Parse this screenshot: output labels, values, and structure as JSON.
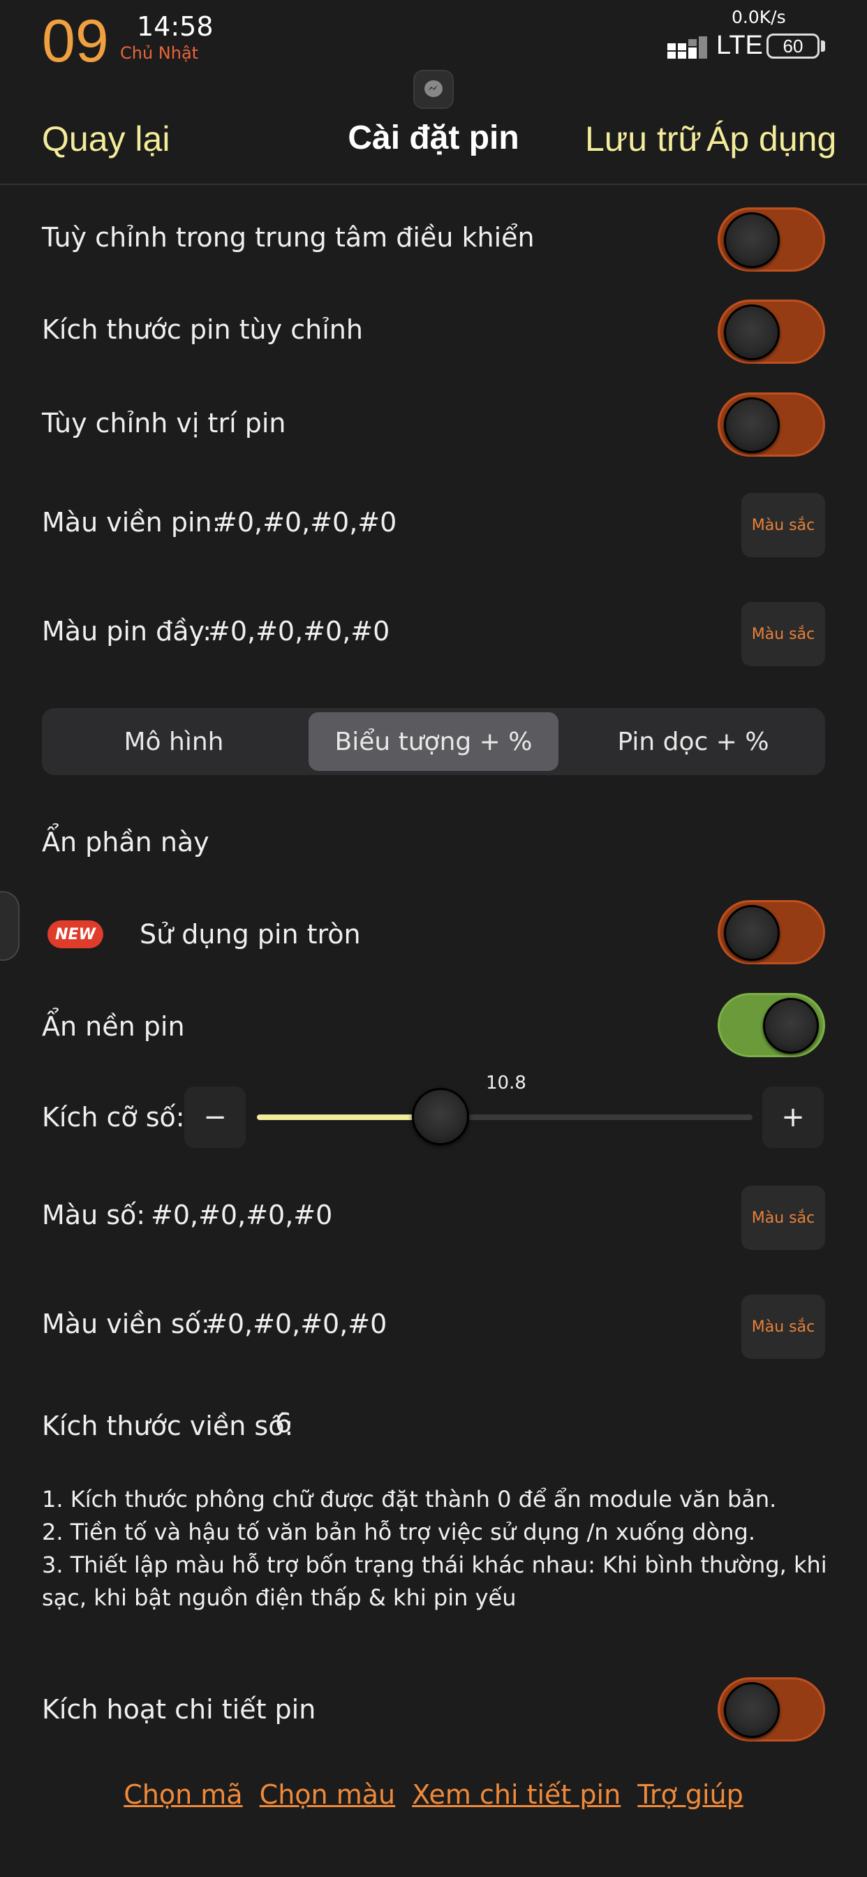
{
  "status_bar": {
    "day": "09",
    "time": "14:58",
    "weekday": "Chủ Nhật",
    "speed": "0.0K/s",
    "network": "LTE",
    "battery": "60"
  },
  "nav": {
    "back": "Quay lại",
    "title": "Cài đặt pin",
    "save": "Lưu trữ",
    "apply": "Áp dụng"
  },
  "settings": {
    "control_center": "Tuỳ chỉnh trong trung tâm điều khiển",
    "custom_size": "Kích thước pin tùy chỉnh",
    "custom_position": "Tùy chỉnh vị trí pin",
    "border_color_label": "Màu viền pin:",
    "border_color_value": "#0,#0,#0,#0",
    "full_color_label": "Màu pin đầy:",
    "full_color_value": "#0,#0,#0,#0",
    "color_button": "Màu sắc"
  },
  "segments": {
    "items": [
      "Mô hình",
      "Biểu tượng + %",
      "Pin dọc + %"
    ],
    "selected": "Biểu tượng + %"
  },
  "section": {
    "hide_title": "Ẩn phần này",
    "new_badge": "NEW",
    "round_battery": "Sử dụng pin tròn",
    "hide_background": "Ẩn nền pin",
    "font_size_label": "Kích cỡ số:",
    "font_size_value": "10.8",
    "minus": "−",
    "plus": "+",
    "number_color_label": "Màu số:",
    "number_color_value": "#0,#0,#0,#0",
    "number_border_color_label": "Màu viền số:",
    "number_border_color_value": "#0,#0,#0,#0",
    "number_border_size_label": "Kích thước viền số:",
    "number_border_size_value": "6"
  },
  "slider": {
    "value_fraction": 0.37
  },
  "notes": [
    "1. Kích thước phông chữ được đặt thành 0 để ẩn module văn bản.",
    "2. Tiền tố và hậu tố văn bản hỗ trợ việc sử dụng /n xuống dòng.",
    "3. Thiết lập màu hỗ trợ bốn trạng thái khác nhau: Khi bình thường, khi sạc, khi bật nguồn điện thấp & khi pin yếu"
  ],
  "details": {
    "enable_label": "Kích hoạt chi tiết pin"
  },
  "links": {
    "choose_code": "Chọn mã",
    "choose_color": "Chọn màu",
    "view_details": "Xem chi tiết pin",
    "help": "Trợ giúp"
  },
  "toggles": {
    "control_center": false,
    "custom_size": false,
    "custom_position": false,
    "round_battery": false,
    "hide_background": true,
    "enable_details": false
  },
  "colors": {
    "accent_yellow": "#f3ec9a",
    "accent_orange": "#f08a3a",
    "toggle_off": "#963c14",
    "toggle_on": "#6a9a3a",
    "background": "#1c1c1c"
  }
}
